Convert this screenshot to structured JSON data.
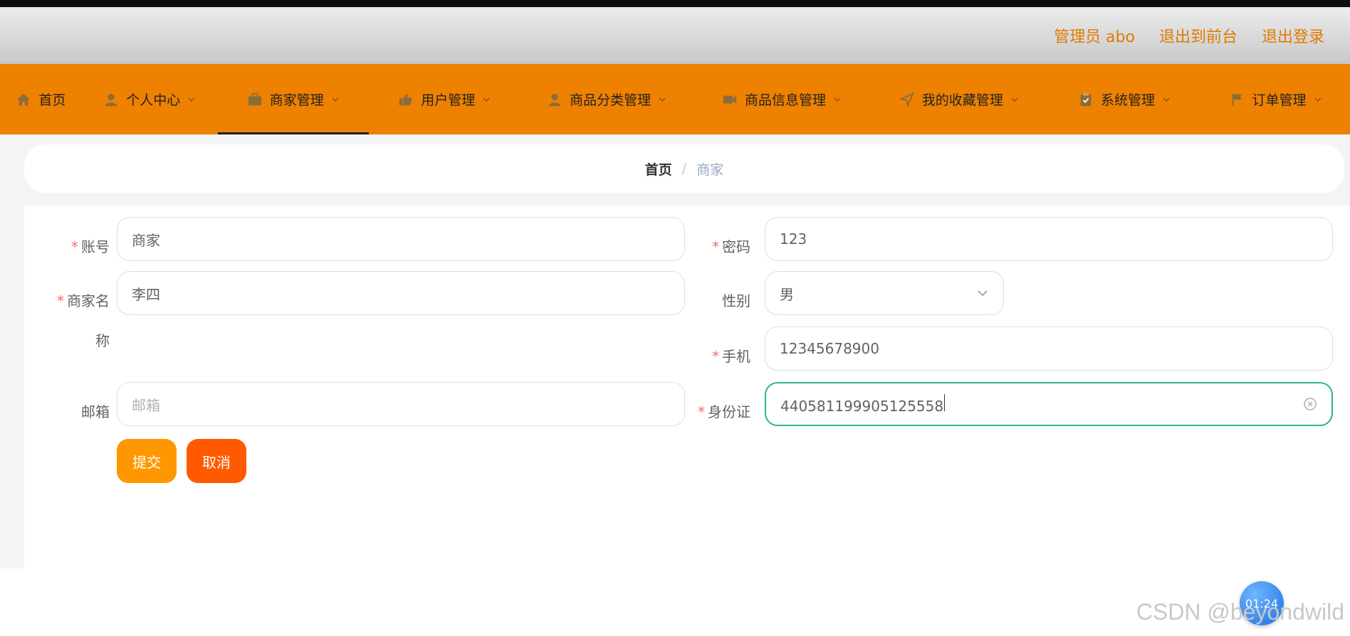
{
  "header": {
    "admin_label": "管理员 abo",
    "front_link": "退出到前台",
    "logout_link": "退出登录"
  },
  "nav": {
    "items": [
      {
        "label": "首页",
        "icon": "home-icon"
      },
      {
        "label": "个人中心",
        "icon": "user-icon"
      },
      {
        "label": "商家管理",
        "icon": "briefcase-icon",
        "active": true
      },
      {
        "label": "用户管理",
        "icon": "thumb-up-icon"
      },
      {
        "label": "商品分类管理",
        "icon": "user-icon"
      },
      {
        "label": "商品信息管理",
        "icon": "film-icon"
      },
      {
        "label": "我的收藏管理",
        "icon": "location-arrow-icon"
      },
      {
        "label": "系统管理",
        "icon": "clipboard-icon"
      },
      {
        "label": "订单管理",
        "icon": "flag-icon"
      }
    ]
  },
  "breadcrumb": {
    "home": "首页",
    "separator": "/",
    "current": "商家"
  },
  "form": {
    "account": {
      "label": "账号",
      "value": "商家"
    },
    "password": {
      "label": "密码",
      "value": "123"
    },
    "merchant_name": {
      "label_line1": "商家名",
      "label_line2": "称",
      "value": "李四"
    },
    "gender": {
      "label": "性别",
      "value": "男"
    },
    "phone": {
      "label": "手机",
      "value": "12345678900"
    },
    "email": {
      "label": "邮箱",
      "placeholder": "邮箱"
    },
    "id_card": {
      "label": "身份证",
      "value": "440581199905125558"
    },
    "required_mark": "*",
    "submit_label": "提交",
    "cancel_label": "取消"
  },
  "overlay": {
    "timer": "01:24",
    "watermark": "CSDN @beyondwild"
  },
  "colors": {
    "nav_bg": "#ee8100",
    "accent_text": "#e07b00",
    "submit_btn": "#ff9800",
    "cancel_btn": "#ff5a00",
    "focus_border": "#2ab39a"
  }
}
